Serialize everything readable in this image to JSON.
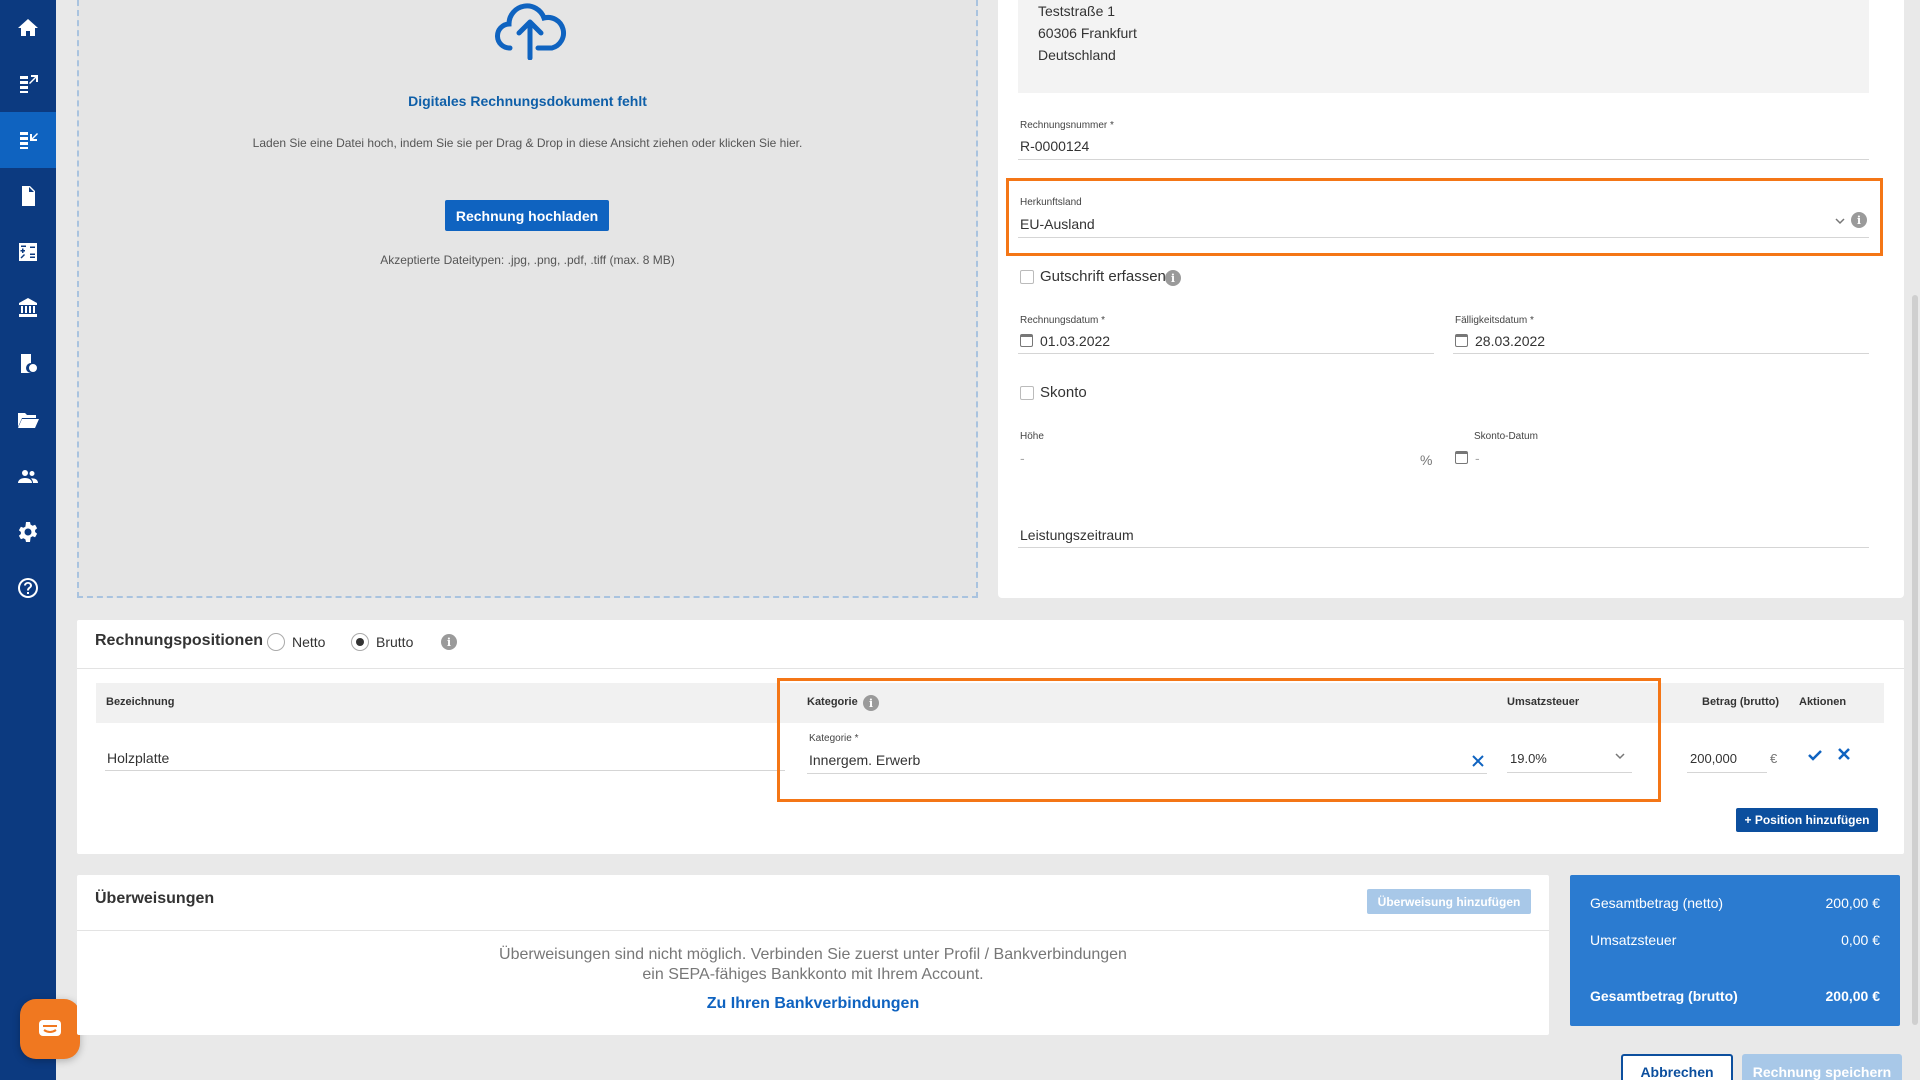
{
  "sidebar": {
    "items": [
      {
        "icon": "home-icon"
      },
      {
        "icon": "outgoing-invoices-icon"
      },
      {
        "icon": "incoming-invoices-icon"
      },
      {
        "icon": "document-icon"
      },
      {
        "icon": "calculator-icon"
      },
      {
        "icon": "bank-icon"
      },
      {
        "icon": "receipt-euro-icon"
      },
      {
        "icon": "folder-icon"
      },
      {
        "icon": "contacts-icon"
      },
      {
        "icon": "settings-icon"
      },
      {
        "icon": "help-icon"
      }
    ],
    "active_index": 2
  },
  "upload": {
    "title": "Digitales Rechnungsdokument fehlt",
    "subtitle": "Laden Sie eine Datei hoch, indem Sie sie per Drag & Drop in diese Ansicht ziehen oder klicken Sie hier.",
    "button": "Rechnung hochladen",
    "types": "Akzeptierte Dateitypen: .jpg, .png, .pdf, .tiff (max. 8 MB)"
  },
  "address": {
    "line1": "Teststraße 1",
    "line2": "60306 Frankfurt",
    "line3": "Deutschland"
  },
  "invoice": {
    "number_label": "Rechnungsnummer *",
    "number": "R-0000124",
    "origin_label": "Herkunftsland",
    "origin": "EU-Ausland",
    "credit_note_label": "Gutschrift erfassen",
    "date_label": "Rechnungsdatum *",
    "date": "01.03.2022",
    "due_label": "Fälligkeitsdatum *",
    "due": "28.03.2022",
    "skonto_label": "Skonto",
    "amount_label": "Höhe",
    "amount": "-",
    "percent": "%",
    "skonto_date_label": "Skonto-Datum",
    "skonto_date": "-",
    "period_label": "Leistungszeitraum"
  },
  "positions": {
    "title": "Rechnungspositionen",
    "netto": "Netto",
    "brutto": "Brutto",
    "selected": "brutto",
    "headers": {
      "designation": "Bezeichnung",
      "category": "Kategorie",
      "vat": "Umsatzsteuer",
      "amount": "Betrag (brutto)",
      "actions": "Aktionen"
    },
    "row": {
      "designation": "Holzplatte",
      "category_label": "Kategorie *",
      "category": "Innergem. Erwerb",
      "vat": "19.0%",
      "amount": "200,000",
      "currency": "€"
    },
    "add_button": "+ Position hinzufügen"
  },
  "transfers": {
    "title": "Überweisungen",
    "add_button": "Überweisung hinzufügen",
    "message_line1": "Überweisungen sind nicht möglich. Verbinden Sie zuerst unter Profil / Bankverbindungen",
    "message_line2": "ein SEPA-fähiges Bankkonto mit Ihrem Account.",
    "link": "Zu Ihren Bankverbindungen"
  },
  "totals": {
    "net_label": "Gesamtbetrag (netto)",
    "net": "200,00 €",
    "vat_label": "Umsatzsteuer",
    "vat": "0,00 €",
    "gross_label": "Gesamtbetrag (brutto)",
    "gross": "200,00 €"
  },
  "footer": {
    "cancel": "Abbrechen",
    "save": "Rechnung speichern"
  },
  "colors": {
    "sidebar": "#0c3a80",
    "accent": "#0f63c0",
    "highlight": "#f47616",
    "totals": "#2b7bd0"
  }
}
